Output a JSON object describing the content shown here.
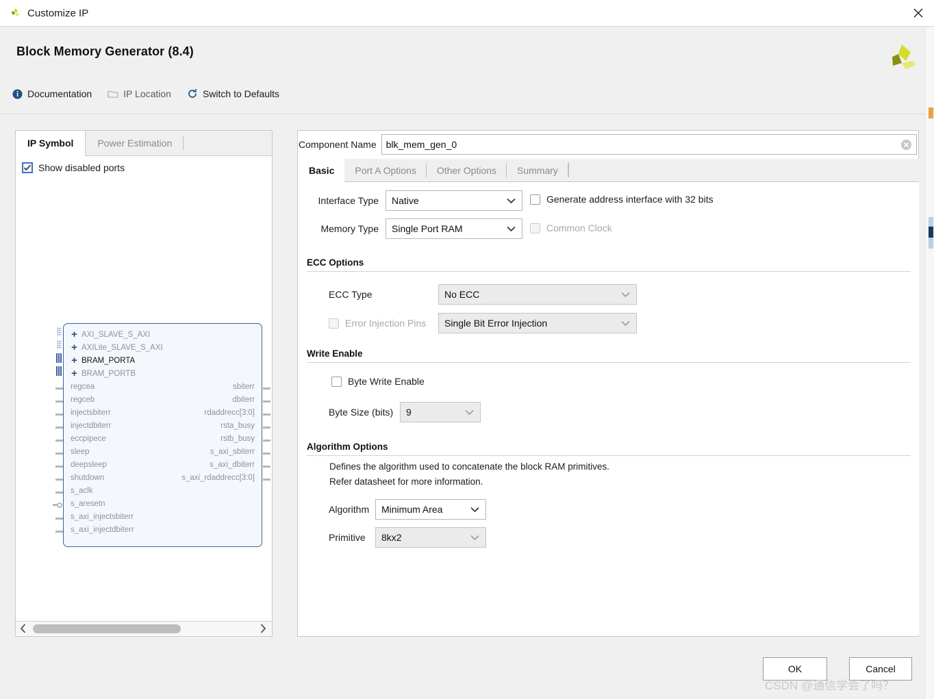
{
  "window": {
    "title": "Customize IP",
    "close_label": "×",
    "app_icon": "xilinx-logo-icon"
  },
  "header": {
    "title": "Block Memory Generator (8.4)",
    "brand_icon": "xilinx-logo-icon",
    "toolbar": [
      {
        "label": "Documentation",
        "icon": "info-icon",
        "disabled": false
      },
      {
        "label": "IP Location",
        "icon": "folder-icon",
        "disabled": true
      },
      {
        "label": "Switch to Defaults",
        "icon": "refresh-icon",
        "disabled": false
      }
    ]
  },
  "left_panel": {
    "tabs": [
      {
        "label": "IP Symbol",
        "active": true
      },
      {
        "label": "Power Estimation",
        "active": false
      }
    ],
    "show_disabled_ports": {
      "label": "Show disabled ports",
      "checked": true
    },
    "symbol": {
      "buses": [
        {
          "label": "AXI_SLAVE_S_AXI",
          "enabled": false,
          "connector": "bus-dotted"
        },
        {
          "label": "AXILite_SLAVE_S_AXI",
          "enabled": false,
          "connector": "bus-dotted"
        },
        {
          "label": "BRAM_PORTA",
          "enabled": true,
          "connector": "bus-solid"
        },
        {
          "label": "BRAM_PORTB",
          "enabled": false,
          "connector": "bus-solid"
        }
      ],
      "inputs": [
        {
          "label": "regcea",
          "connector": "pin"
        },
        {
          "label": "regceb",
          "connector": "pin"
        },
        {
          "label": "injectsbiterr",
          "connector": "pin"
        },
        {
          "label": "injectdbiterr",
          "connector": "pin"
        },
        {
          "label": "eccpipece",
          "connector": "pin"
        },
        {
          "label": "sleep",
          "connector": "pin"
        },
        {
          "label": "deepsleep",
          "connector": "pin"
        },
        {
          "label": "shutdown",
          "connector": "pin"
        },
        {
          "label": "s_aclk",
          "connector": "pin"
        },
        {
          "label": "s_aresetn",
          "connector": "pin-bubble"
        },
        {
          "label": "s_axi_injectsbiterr",
          "connector": "pin"
        },
        {
          "label": "s_axi_injectdbiterr",
          "connector": "pin"
        }
      ],
      "outputs": [
        {
          "label": "sbiterr"
        },
        {
          "label": "dbiterr"
        },
        {
          "label": "rdaddrecc[3:0]"
        },
        {
          "label": "rsta_busy"
        },
        {
          "label": "rstb_busy"
        },
        {
          "label": "s_axi_sbiterr"
        },
        {
          "label": "s_axi_dbiterr"
        },
        {
          "label": "s_axi_rdaddrecc[3:0]"
        }
      ]
    },
    "scrollbar": {
      "left_arrow": "‹",
      "right_arrow": "›"
    }
  },
  "right_panel": {
    "component_name": {
      "label": "Component Name",
      "value": "blk_mem_gen_0",
      "clear_icon": "clear-circle-icon"
    },
    "tabs": [
      {
        "label": "Basic",
        "active": true
      },
      {
        "label": "Port A Options",
        "active": false
      },
      {
        "label": "Other Options",
        "active": false
      },
      {
        "label": "Summary",
        "active": false
      }
    ],
    "basic": {
      "interface_type": {
        "label": "Interface Type",
        "value": "Native",
        "disabled": false
      },
      "memory_type": {
        "label": "Memory Type",
        "value": "Single Port RAM",
        "disabled": false
      },
      "generate_address_interface": {
        "label": "Generate address interface with 32 bits",
        "checked": false,
        "disabled": false
      },
      "common_clock": {
        "label": "Common Clock",
        "checked": false,
        "disabled": true
      },
      "ecc_options": {
        "title": "ECC Options",
        "ecc_type": {
          "label": "ECC Type",
          "value": "No ECC",
          "disabled": true
        },
        "error_injection_pins": {
          "label": "Error Injection Pins",
          "checked": false,
          "disabled": true,
          "value": "Single Bit Error Injection"
        }
      },
      "write_enable": {
        "title": "Write Enable",
        "byte_write_enable": {
          "label": "Byte Write Enable",
          "checked": false
        },
        "byte_size": {
          "label": "Byte Size (bits)",
          "value": "9",
          "disabled": true
        }
      },
      "algorithm_options": {
        "title": "Algorithm Options",
        "description_line1": "Defines the algorithm used to concatenate the block RAM primitives.",
        "description_line2": "Refer datasheet for more information.",
        "algorithm": {
          "label": "Algorithm",
          "value": "Minimum Area",
          "disabled": false
        },
        "primitive": {
          "label": "Primitive",
          "value": "8kx2",
          "disabled": true
        }
      }
    }
  },
  "footer": {
    "ok_label": "OK",
    "cancel_label": "Cancel"
  },
  "watermark": {
    "text": "CSDN @通信学会了吗？"
  }
}
